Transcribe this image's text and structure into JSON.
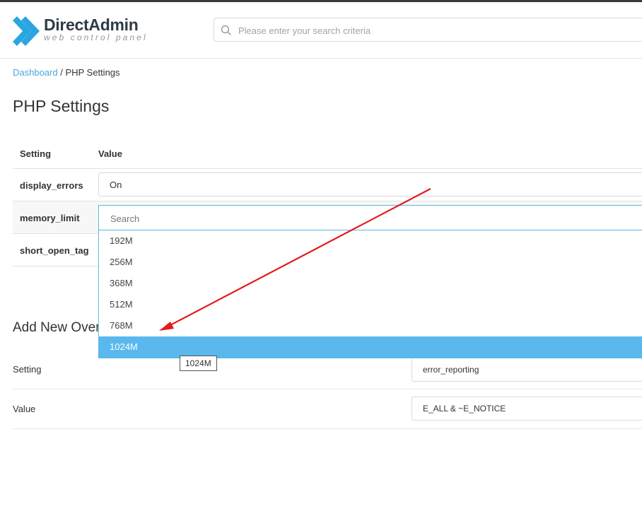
{
  "app": {
    "name": "DirectAdmin",
    "tagline": "web control panel"
  },
  "search": {
    "placeholder": "Please enter your search criteria"
  },
  "breadcrumb": {
    "root": "Dashboard",
    "separator": " / ",
    "current": "PHP Settings"
  },
  "page": {
    "title": "PHP Settings"
  },
  "table": {
    "headers": {
      "setting": "Setting",
      "value": "Value"
    },
    "rows": [
      {
        "key": "display_errors",
        "value": "On"
      },
      {
        "key": "memory_limit",
        "value": ""
      },
      {
        "key": "short_open_tag",
        "value": ""
      }
    ]
  },
  "dropdown": {
    "search_placeholder": "Search",
    "options": [
      "192M",
      "256M",
      "368M",
      "512M",
      "768M",
      "1024M"
    ],
    "highlighted": "1024M",
    "tooltip": "1024M"
  },
  "add_override": {
    "title": "Add New Override",
    "setting_label": "Setting",
    "setting_value": "error_reporting",
    "value_label": "Value",
    "value_value": "E_ALL & ~E_NOTICE"
  },
  "colors": {
    "accent": "#5ab8ee",
    "link": "#4aa8d8",
    "annotation": "#e31b1b",
    "logo": "#29a6e0"
  },
  "icons": {
    "logo": "directadmin-logo-icon",
    "search": "search-icon"
  }
}
